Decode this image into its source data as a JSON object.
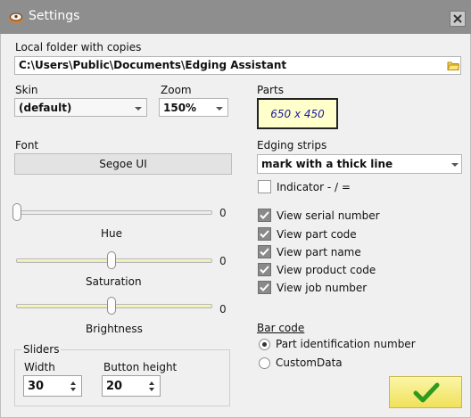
{
  "window": {
    "title": "Settings"
  },
  "folder": {
    "label": "Local folder with copies",
    "value": "C:\\Users\\Public\\Documents\\Edging Assistant"
  },
  "skin": {
    "label": "Skin",
    "value": "(default)"
  },
  "zoom": {
    "label": "Zoom",
    "value": "150%"
  },
  "parts": {
    "label": "Parts",
    "value": "650 x 450"
  },
  "font": {
    "label": "Font",
    "value": "Segoe UI"
  },
  "edging": {
    "label": "Edging strips",
    "value": "mark with a thick line",
    "indicator_label": "Indicator - / =",
    "indicator_checked": false
  },
  "sliders": [
    {
      "label": "Hue",
      "value": "0",
      "level": 0
    },
    {
      "label": "Saturation",
      "value": "0",
      "level": 0.5
    },
    {
      "label": "Brightness",
      "value": "0",
      "level": 0.5
    }
  ],
  "views": [
    {
      "label": "View serial number",
      "checked": true
    },
    {
      "label": "View part code",
      "checked": true
    },
    {
      "label": "View part name",
      "checked": true
    },
    {
      "label": "View product code",
      "checked": true
    },
    {
      "label": "View job number",
      "checked": true
    }
  ],
  "barcode": {
    "label": "Bar code",
    "options": [
      {
        "label": "Part identification number",
        "selected": true
      },
      {
        "label": "CustomData",
        "selected": false
      }
    ]
  },
  "slider_settings": {
    "group_label": "Sliders",
    "width_label": "Width",
    "width_value": "30",
    "button_height_label": "Button height",
    "button_height_value": "20"
  },
  "colors": {
    "titlebar": "#8e8e8e",
    "parts_bg": "#ffffcc",
    "parts_text": "#1a1aa0",
    "ok_check": "#2e9a1f"
  },
  "icons": {
    "app": "app-icon",
    "close": "close-icon",
    "folder": "folder-icon",
    "ok": "checkmark-icon"
  }
}
